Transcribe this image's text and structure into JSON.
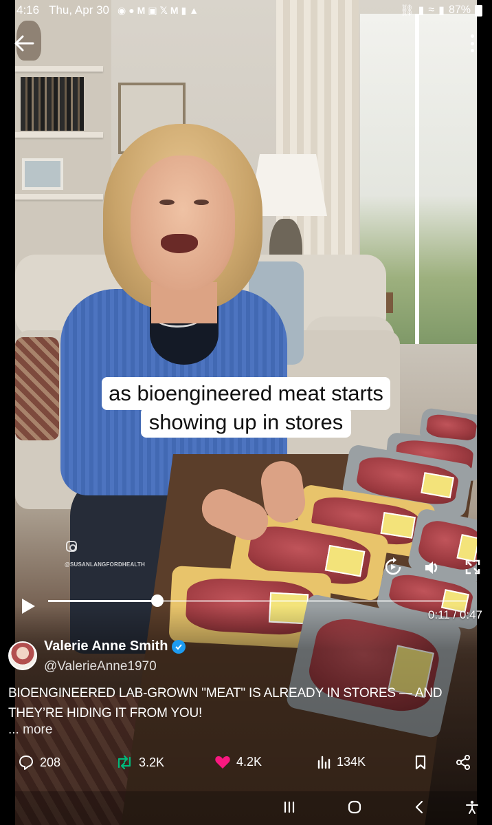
{
  "status_bar": {
    "time": "4:16",
    "date": "Thu, Apr 30",
    "battery": "87%"
  },
  "video": {
    "caption_line1": "as bioengineered meat starts",
    "caption_line2": "showing up in stores",
    "watermark": "@SUSANLANGFORDHEALTH",
    "current_time": "0:11",
    "duration": "0:47",
    "time_readout": "0:11 / 0:47",
    "progress": 0.26
  },
  "post": {
    "author_name": "Valerie Anne Smith",
    "author_handle": "@ValerieAnne1970",
    "text": "BIOENGINEERED LAB-GROWN \"MEAT\" IS ALREADY IN STORES — AND THEY’RE HIDING IT FROM YOU!",
    "more_label": "... more"
  },
  "actions": {
    "replies": "208",
    "reposts": "3.2K",
    "likes": "4.2K",
    "views": "134K"
  },
  "colors": {
    "repost_green": "#00ba7c",
    "like_pink": "#f91880",
    "verified_blue": "#1d9bf0"
  }
}
